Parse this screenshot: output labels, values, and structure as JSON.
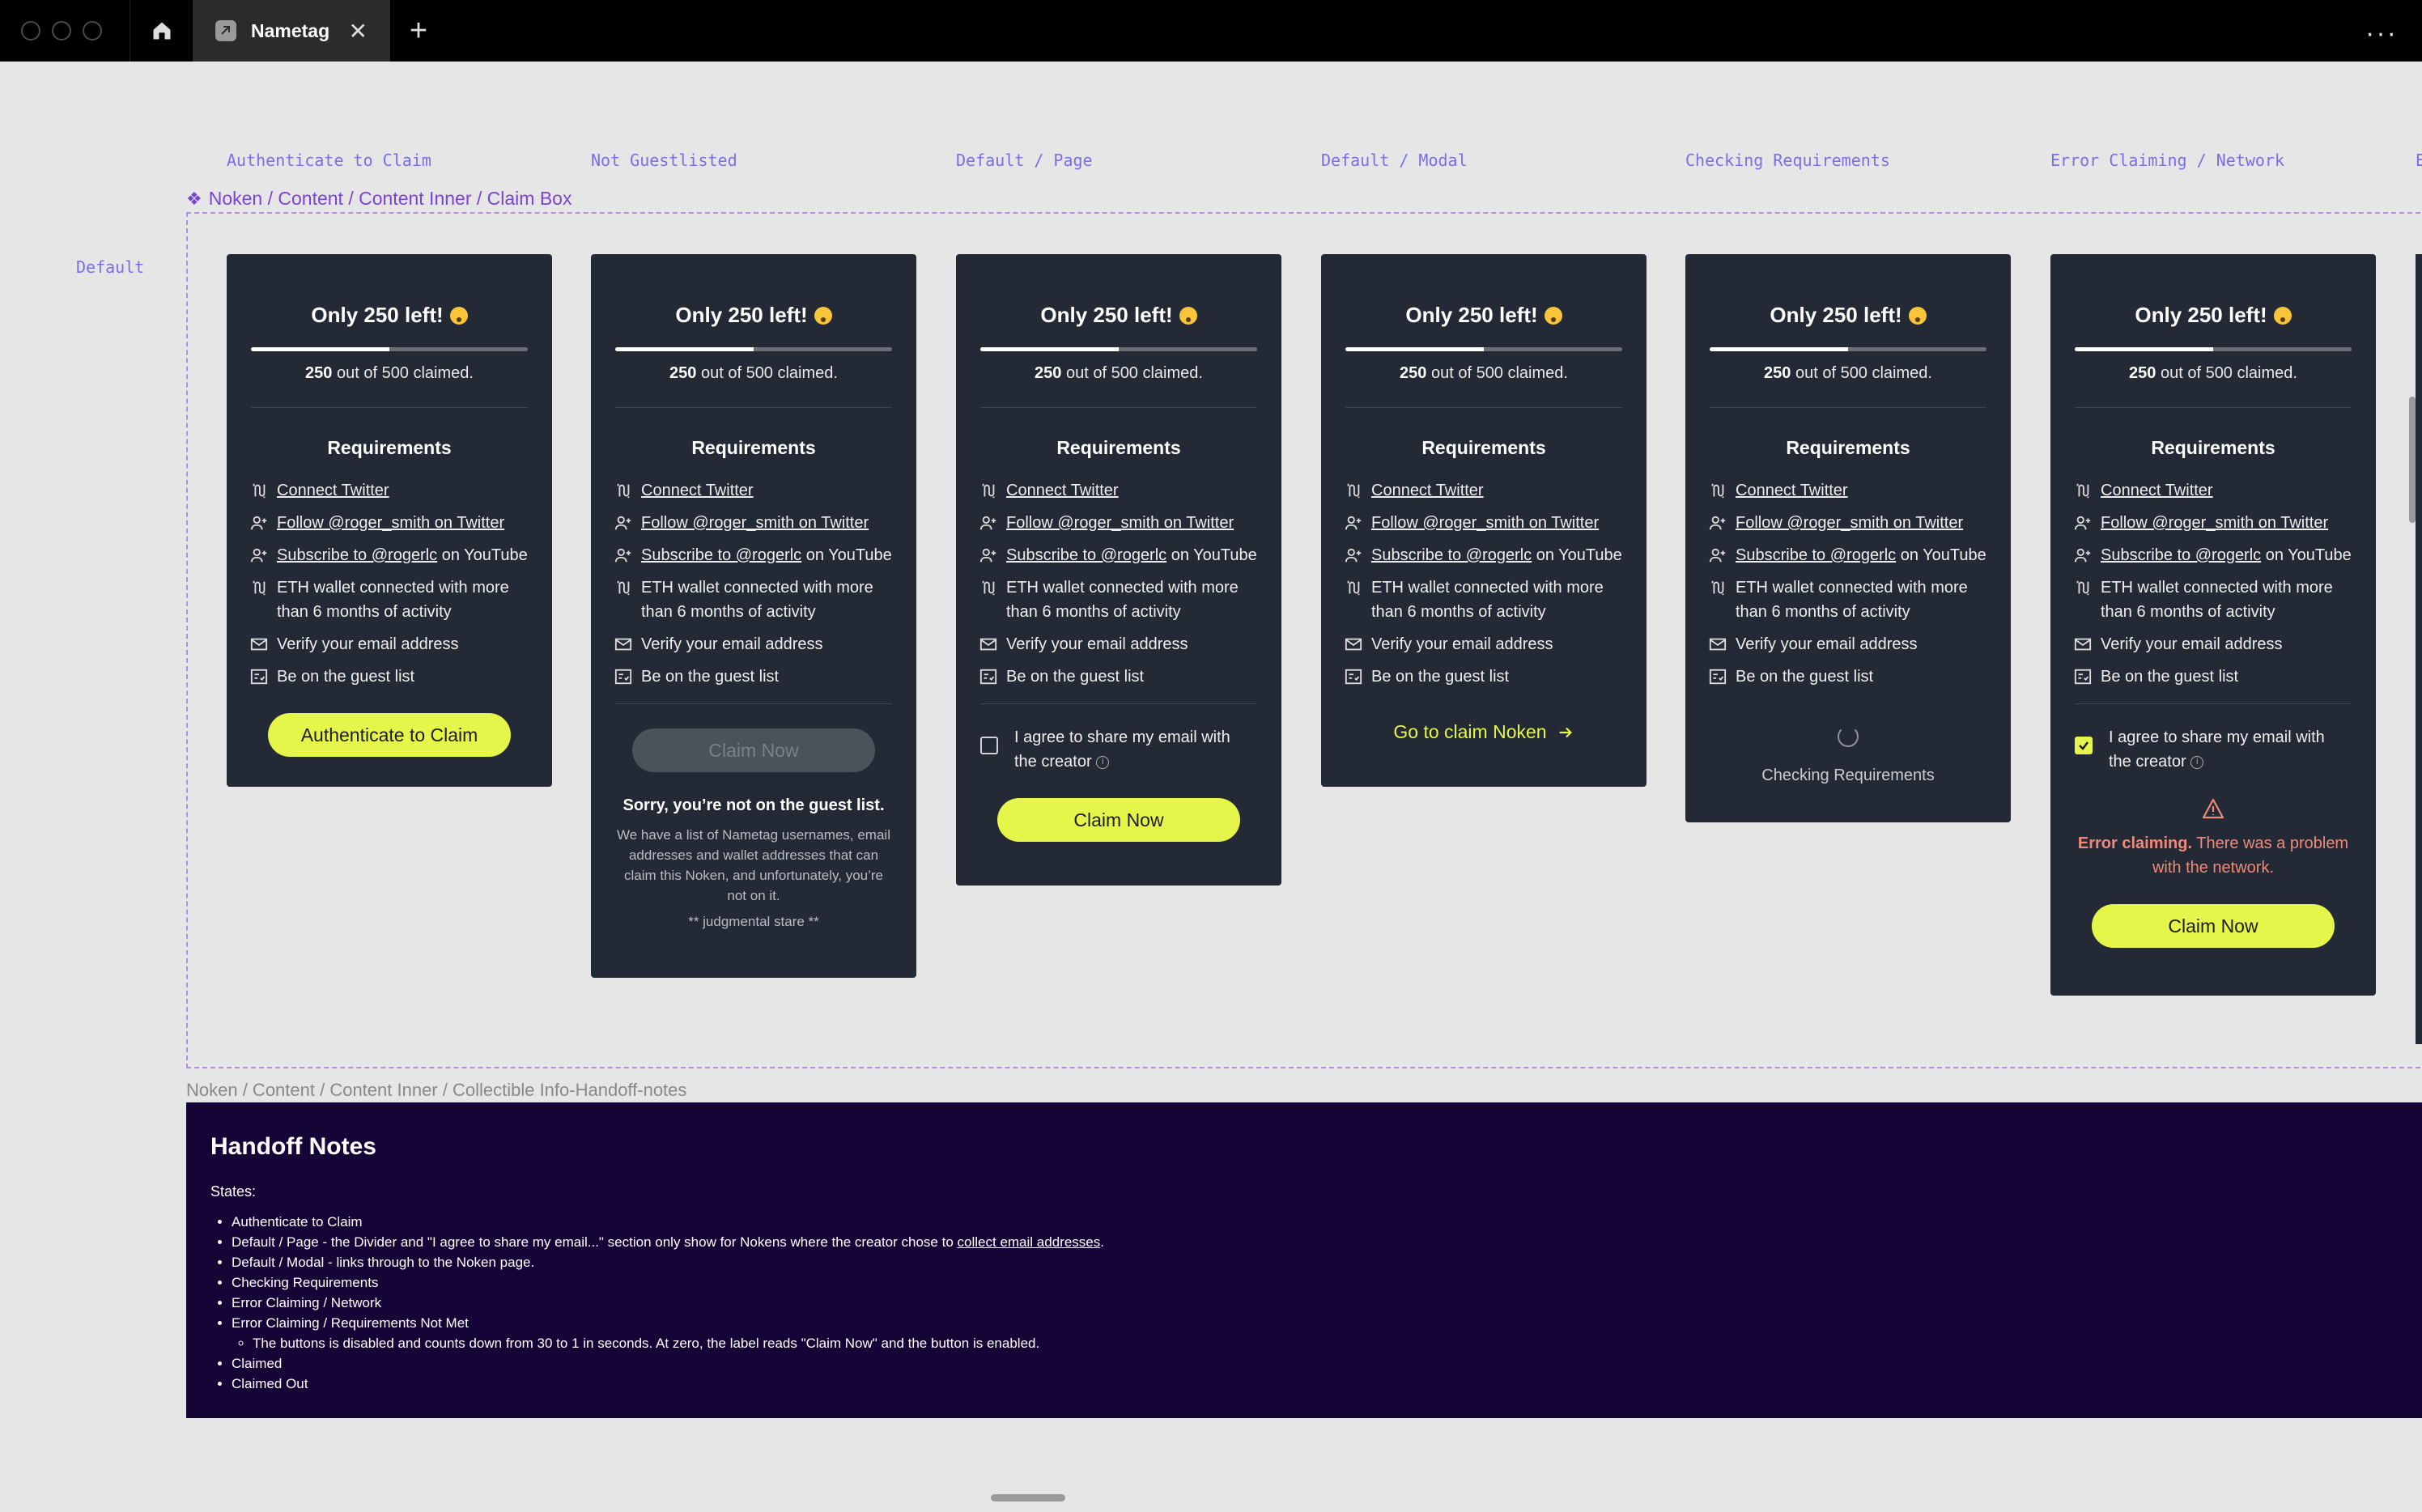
{
  "window": {
    "tab_title": "Nametag",
    "tab_close": "✕",
    "new_tab": "+",
    "menu": "···"
  },
  "columns": [
    "Authenticate to Claim",
    "Not Guestlisted",
    "Default / Page",
    "Default / Modal",
    "Checking Requirements",
    "Error Claiming / Network",
    "E"
  ],
  "row_label": "Default",
  "component_label": "Noken / Content / Content Inner / Claim Box",
  "card": {
    "title": "Only 250 left!",
    "claimed_count": "250",
    "claimed_rest": "out of 500 claimed.",
    "claimed_fraction": 0.5,
    "requirements_title": "Requirements",
    "requirements": {
      "twitter": "Connect Twitter",
      "follow": "Follow @roger_smith on Twitter",
      "subscribe_link": "Subscribe to @rogerlc",
      "subscribe_rest": "on YouTube",
      "eth": "ETH wallet connected with more than 6 months of activity",
      "email": "Verify your email address",
      "guest": "Be on the guest list"
    },
    "consent": "I agree to share my email with the creator",
    "info_glyph": "i"
  },
  "states": {
    "auth": {
      "button": "Authenticate to Claim"
    },
    "not_guest": {
      "button": "Claim Now",
      "sorry_title": "Sorry, you’re not on the guest list.",
      "sorry_text": "We have a list of Nametag usernames, email addresses and wallet addresses that can claim this Noken, and unfortunately, you’re not on it.",
      "stare": "** judgmental stare **"
    },
    "default_page": {
      "button": "Claim Now"
    },
    "default_modal": {
      "link": "Go to claim Noken"
    },
    "checking": {
      "text": "Checking Requirements"
    },
    "error": {
      "bold": "Error claiming.",
      "rest": "There was a problem with the network.",
      "button": "Claim Now"
    }
  },
  "handoff": {
    "label": "Noken / Content / Content Inner / Collectible Info-Handoff-notes",
    "title": "Handoff Notes",
    "states_label": "States:",
    "items": {
      "i1": "Authenticate to Claim",
      "i2_pre": "Default / Page - the Divider and \"I agree to share my email...\" section only show for Nokens where the creator chose to",
      "i2_link": "collect email addresses",
      "i2_post": ".",
      "i3": "Default / Modal - links through to the Noken page.",
      "i4": "Checking Requirements",
      "i5": "Error Claiming / Network",
      "i6": "Error Claiming / Requirements Not Met",
      "i6_sub": "The buttons is disabled and counts down from 30 to 1 in seconds. At zero, the label reads \"Claim Now\" and the button is enabled.",
      "i7": "Claimed",
      "i8": "Claimed Out"
    }
  },
  "colors": {
    "card_bg": "#232a36",
    "accent": "#e5f54a",
    "frame_purple": "#7a44d6",
    "handoff_bg": "#150436",
    "error": "#f08a78"
  }
}
